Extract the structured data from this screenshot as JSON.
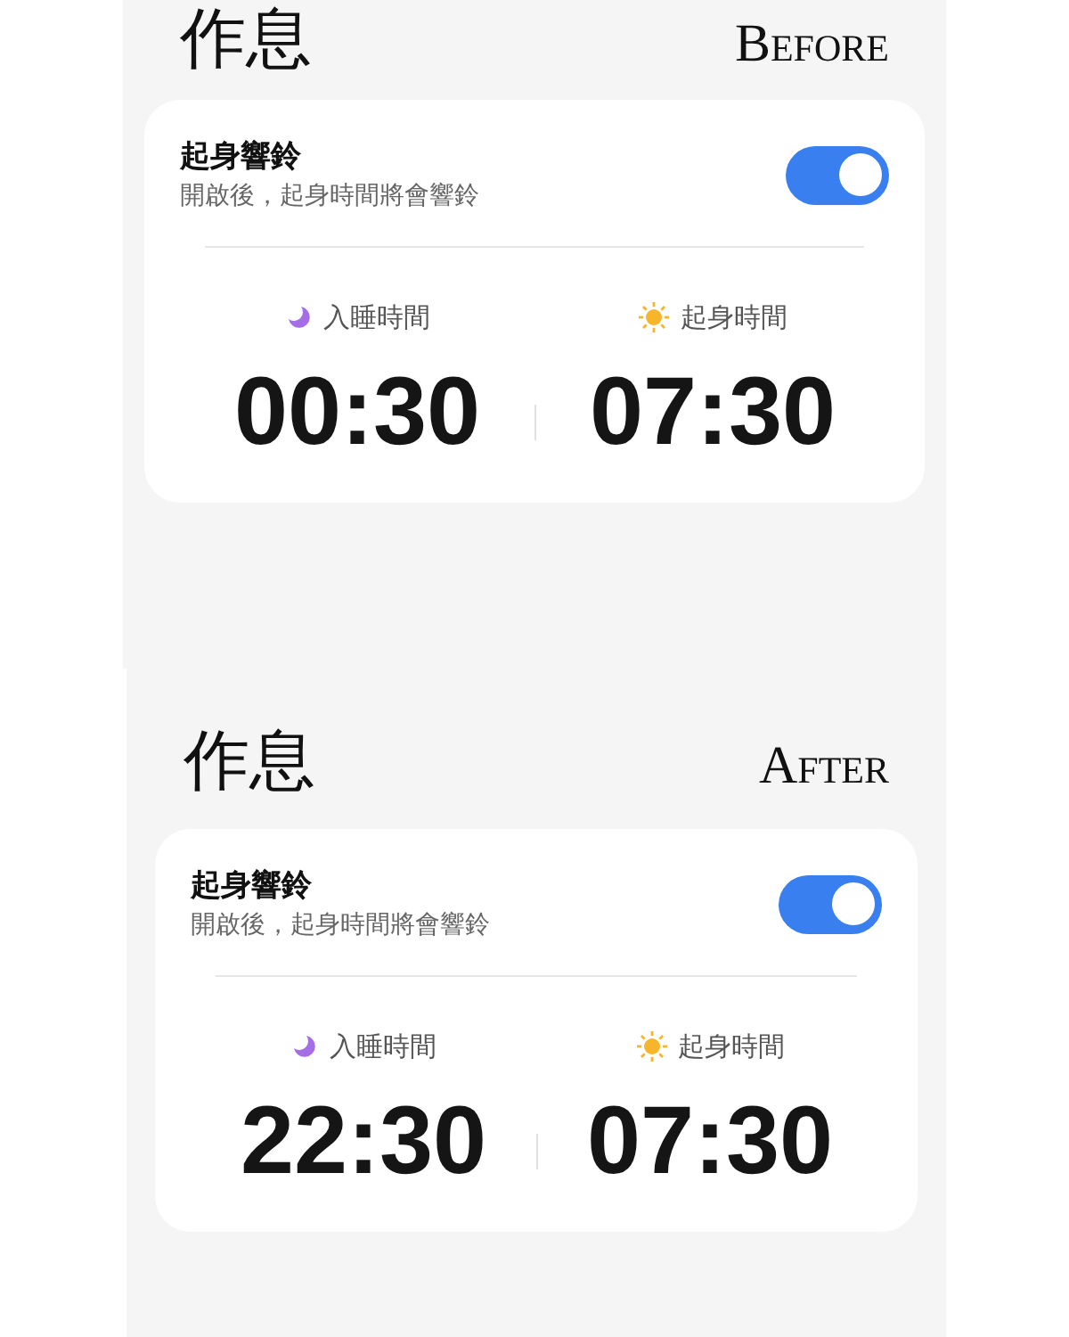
{
  "sections": [
    {
      "title": "作息",
      "label": "Before",
      "alarm": {
        "title": "起身響鈴",
        "subtitle": "開啟後，起身時間將會響鈴",
        "on": true
      },
      "times": [
        {
          "kind": "sleep",
          "label": "入睡時間",
          "time": "00:30"
        },
        {
          "kind": "wake",
          "label": "起身時間",
          "time": "07:30"
        }
      ]
    },
    {
      "title": "作息",
      "label": "After",
      "alarm": {
        "title": "起身響鈴",
        "subtitle": "開啟後，起身時間將會響鈴",
        "on": true
      },
      "times": [
        {
          "kind": "sleep",
          "label": "入睡時間",
          "time": "22:30"
        },
        {
          "kind": "wake",
          "label": "起身時間",
          "time": "07:30"
        }
      ]
    }
  ]
}
